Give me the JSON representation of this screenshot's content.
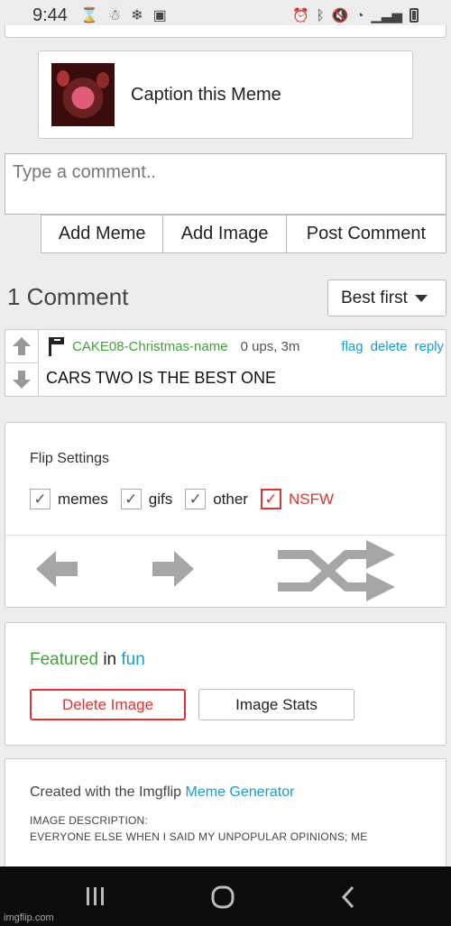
{
  "status_bar": {
    "time": "9:44",
    "left_icons": [
      "hourglass-icon",
      "snowman-icon",
      "snowflake-icon",
      "image-icon"
    ],
    "right_icons": [
      "alarm-icon",
      "bluetooth-icon",
      "mute-icon",
      "wifi-icon",
      "signal-icon",
      "battery-icon"
    ]
  },
  "caption_card": {
    "label": "Caption this Meme"
  },
  "comment_input": {
    "placeholder": "Type a comment.."
  },
  "comment_actions": {
    "add_meme": "Add Meme",
    "add_image": "Add Image",
    "post_comment": "Post Comment"
  },
  "comments_header": {
    "count_label": "1 Comment",
    "sort_value": "Best first"
  },
  "comments": [
    {
      "user": "CAKE08-Christmas-name",
      "stats": "0 ups, 3m",
      "links": {
        "flag": "flag",
        "delete": "delete",
        "reply": "reply"
      },
      "text": "CARS TWO IS THE BEST ONE"
    }
  ],
  "flip_settings": {
    "title": "Flip Settings",
    "options": [
      {
        "label": "memes",
        "checked": true
      },
      {
        "label": "gifs",
        "checked": true
      },
      {
        "label": "other",
        "checked": true
      },
      {
        "label": "NSFW",
        "checked": true
      }
    ]
  },
  "featured": {
    "prefix": "Featured",
    "middle": "in",
    "stream": "fun",
    "delete_label": "Delete Image",
    "stats_label": "Image Stats"
  },
  "created": {
    "prefix": "Created with the Imgflip",
    "link": "Meme Generator",
    "description_label": "IMAGE DESCRIPTION:",
    "description_text": "EVERYONE ELSE WHEN I SAID MY UNPOPULAR OPINIONS; ME"
  },
  "nav_bar": {
    "recents": "recents-icon",
    "home": "home-icon",
    "back": "back-icon"
  },
  "watermark": "imgflip.com",
  "colors": {
    "green": "#41a33b",
    "blue": "#1a9ad6",
    "red": "#d33333"
  }
}
